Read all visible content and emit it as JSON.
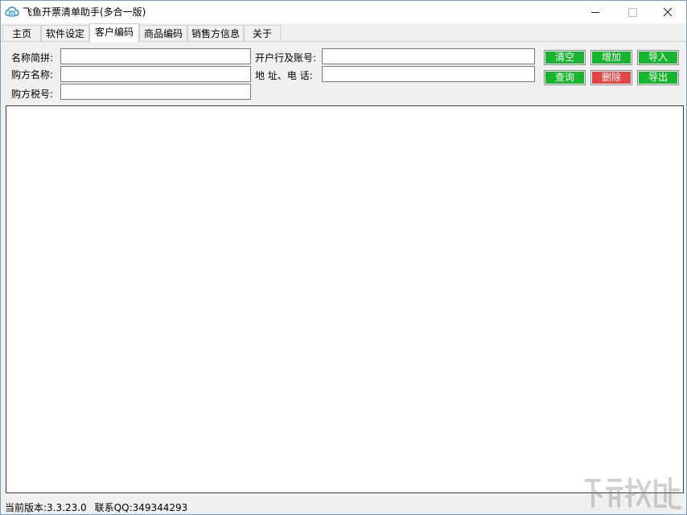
{
  "window": {
    "title": "飞鱼开票清单助手(多合一版)",
    "icon": "cloud-invoice-icon"
  },
  "tabs": [
    {
      "label": "主页",
      "active": false
    },
    {
      "label": "软件设定",
      "active": false
    },
    {
      "label": "客户编码",
      "active": true
    },
    {
      "label": "商品编码",
      "active": false
    },
    {
      "label": "销售方信息",
      "active": false
    },
    {
      "label": "关于",
      "active": false
    }
  ],
  "form": {
    "name_pinyin_label": "名称简拼:",
    "name_pinyin_value": "",
    "buyer_name_label": "购方名称:",
    "buyer_name_value": "",
    "buyer_taxid_label": "购方税号:",
    "buyer_taxid_value": "",
    "bank_account_label": "开户行及账号:",
    "bank_account_value": "",
    "address_phone_label": "地 址、电  话:",
    "address_phone_value": ""
  },
  "buttons": {
    "clear": "清空",
    "add": "增加",
    "import": "导入",
    "query": "查询",
    "delete": "删除",
    "export": "导出"
  },
  "colors": {
    "button_green": "#18b52e",
    "button_red": "#e34646"
  },
  "status": {
    "version": "当前版本:3.3.23.0",
    "contact": "联系QQ:349344293"
  }
}
